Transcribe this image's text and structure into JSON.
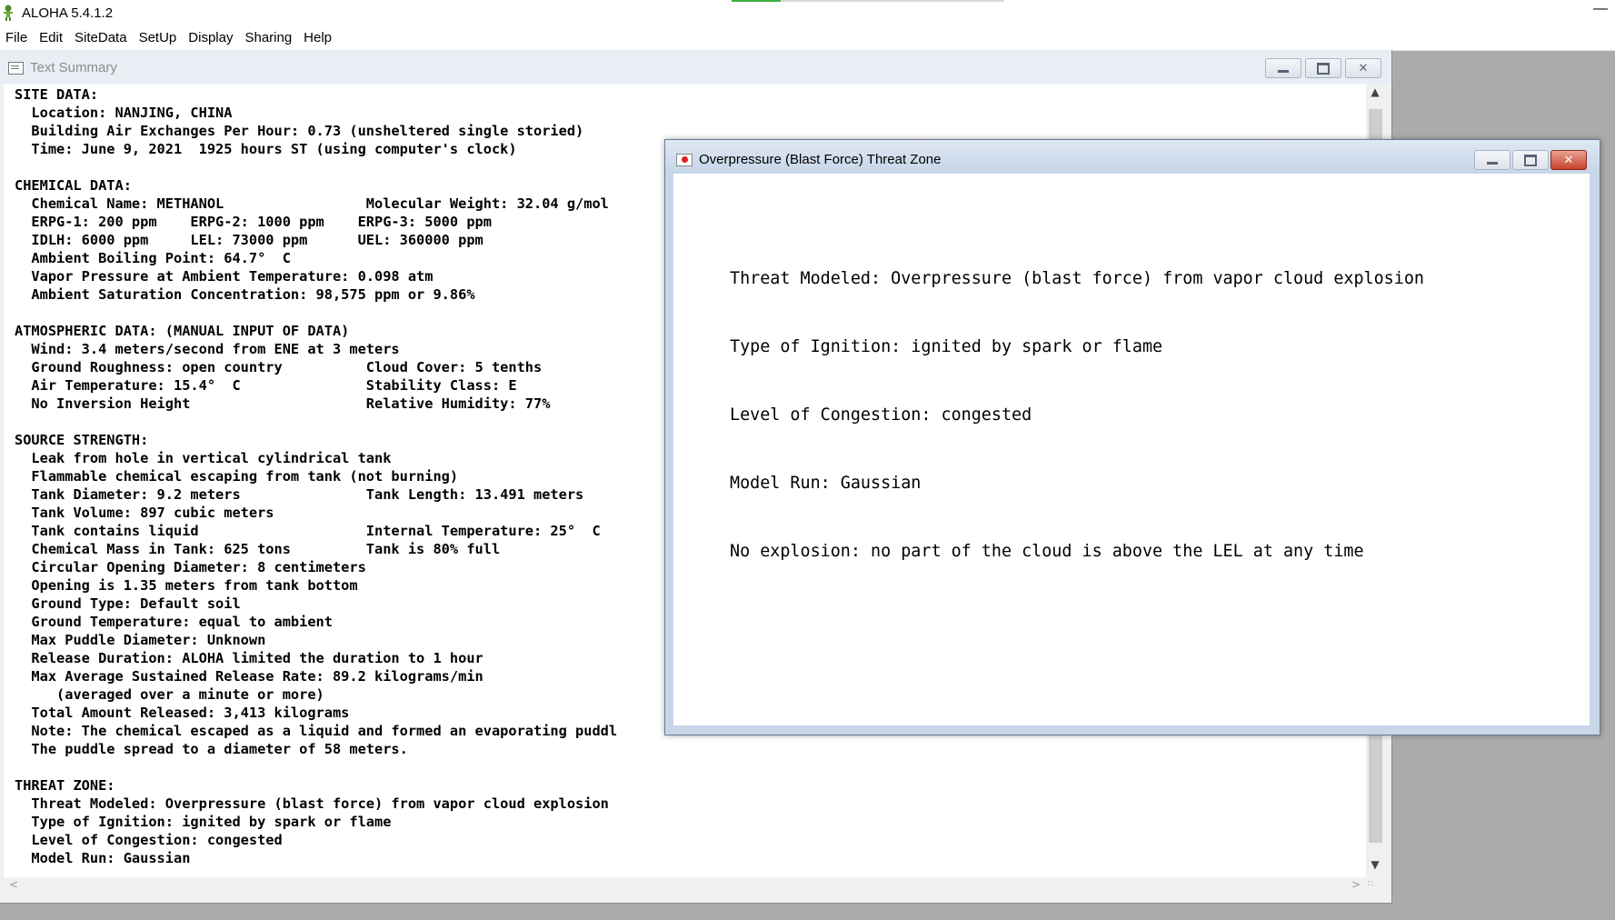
{
  "app": {
    "title": "ALOHA 5.4.1.2",
    "minimize_glyph": "—",
    "progress": 0.18
  },
  "menu": {
    "items": [
      "File",
      "Edit",
      "SiteData",
      "SetUp",
      "Display",
      "Sharing",
      "Help"
    ]
  },
  "summary_window": {
    "title": "Text Summary",
    "text": "SITE DATA:\n  Location: NANJING, CHINA\n  Building Air Exchanges Per Hour: 0.73 (unsheltered single storied)\n  Time: June 9, 2021  1925 hours ST (using computer's clock)\n\nCHEMICAL DATA:\n  Chemical Name: METHANOL                 Molecular Weight: 32.04 g/mol\n  ERPG-1: 200 ppm    ERPG-2: 1000 ppm    ERPG-3: 5000 ppm\n  IDLH: 6000 ppm     LEL: 73000 ppm      UEL: 360000 ppm\n  Ambient Boiling Point: 64.7°  C\n  Vapor Pressure at Ambient Temperature: 0.098 atm\n  Ambient Saturation Concentration: 98,575 ppm or 9.86%\n\nATMOSPHERIC DATA: (MANUAL INPUT OF DATA)\n  Wind: 3.4 meters/second from ENE at 3 meters\n  Ground Roughness: open country          Cloud Cover: 5 tenths\n  Air Temperature: 15.4°  C               Stability Class: E\n  No Inversion Height                     Relative Humidity: 77%\n\nSOURCE STRENGTH:\n  Leak from hole in vertical cylindrical tank\n  Flammable chemical escaping from tank (not burning)\n  Tank Diameter: 9.2 meters               Tank Length: 13.491 meters\n  Tank Volume: 897 cubic meters\n  Tank contains liquid                    Internal Temperature: 25°  C\n  Chemical Mass in Tank: 625 tons         Tank is 80% full\n  Circular Opening Diameter: 8 centimeters\n  Opening is 1.35 meters from tank bottom\n  Ground Type: Default soil\n  Ground Temperature: equal to ambient\n  Max Puddle Diameter: Unknown\n  Release Duration: ALOHA limited the duration to 1 hour\n  Max Average Sustained Release Rate: 89.2 kilograms/min\n     (averaged over a minute or more)\n  Total Amount Released: 3,413 kilograms\n  Note: The chemical escaped as a liquid and formed an evaporating puddl\n  The puddle spread to a diameter of 58 meters.\n\nTHREAT ZONE:\n  Threat Modeled: Overpressure (blast force) from vapor cloud explosion\n  Type of Ignition: ignited by spark or flame\n  Level of Congestion: congested\n  Model Run: Gaussian",
    "vscroll_up": "▲",
    "vscroll_down": "▼",
    "hscroll_left": "<",
    "hscroll_right": ">",
    "grip": "∷"
  },
  "threat_window": {
    "title": "Overpressure (Blast Force) Threat Zone",
    "lines": [
      "Threat Modeled: Overpressure (blast force) from vapor cloud explosion",
      "Type of Ignition: ignited by spark or flame",
      "Level of Congestion: congested",
      "Model Run: Gaussian",
      "No explosion: no part of the cloud is above the LEL at any time"
    ]
  },
  "colors": {
    "desktop": "#ababab",
    "progress_fill": "#3cb043",
    "close_button": "#c9412c"
  }
}
